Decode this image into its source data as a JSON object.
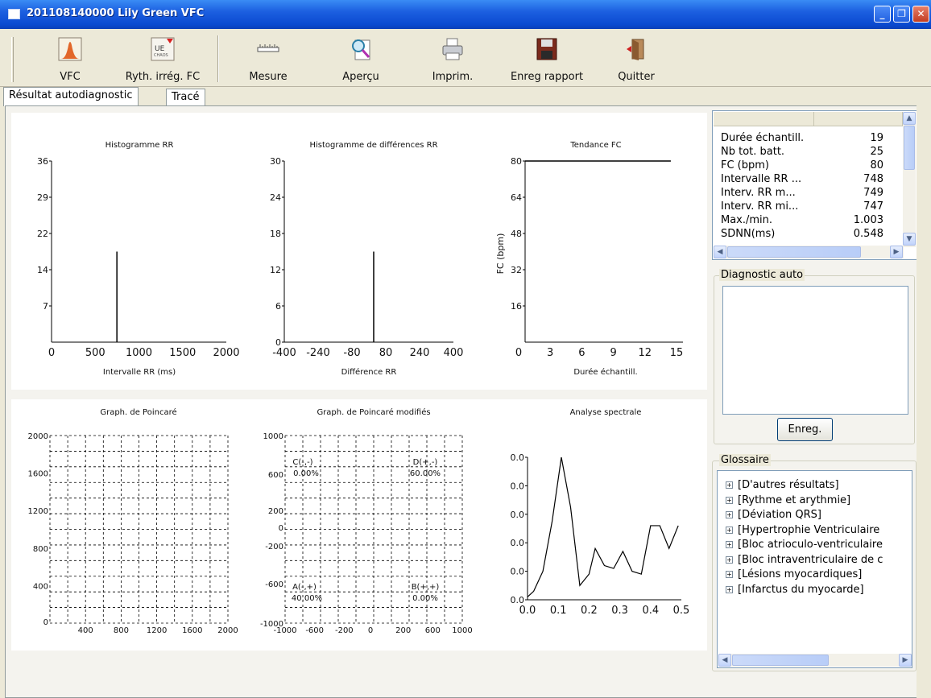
{
  "window": {
    "title": "201108140000  Lily Green  VFC",
    "minimize_glyph": "_",
    "restore_glyph": "❐",
    "close_glyph": "✕"
  },
  "toolbar": {
    "items": [
      {
        "label": "VFC",
        "icon": "hrv-chart-icon"
      },
      {
        "label": "Ryth. irrég. FC",
        "icon": "irregular-rhythm-icon"
      },
      {
        "label": "Mesure",
        "icon": "ruler-icon"
      },
      {
        "label": "Aperçu",
        "icon": "preview-magnifier-icon"
      },
      {
        "label": "Imprim.",
        "icon": "printer-icon"
      },
      {
        "label": "Enreg rapport",
        "icon": "floppy-disk-icon"
      },
      {
        "label": "Quitter",
        "icon": "exit-door-icon"
      }
    ]
  },
  "tabs": [
    {
      "label": "Résultat autodiagnostic",
      "active": true
    },
    {
      "label": "Tracé",
      "active": false
    }
  ],
  "charts": {
    "rr_histogram": {
      "title": "Histogramme RR",
      "xlabel": "Intervalle RR (ms)",
      "yticks": [
        "36",
        "29",
        "22",
        "14",
        "7"
      ],
      "xticks": [
        "0",
        "500",
        "1000",
        "1500",
        "2000"
      ]
    },
    "diff_histogram": {
      "title": "Histogramme de différences RR",
      "xlabel": "Différence RR",
      "yticks": [
        "30",
        "24",
        "18",
        "12",
        "6",
        "0"
      ],
      "xticks": [
        "-400",
        "-240",
        "-80",
        "80",
        "240",
        "400"
      ]
    },
    "hr_trend": {
      "title": "Tendance FC",
      "xlabel": "Durée échantill.",
      "ylabel": "FC (bpm)",
      "yticks": [
        "80",
        "64",
        "48",
        "32",
        "16"
      ],
      "xticks": [
        "0",
        "3",
        "6",
        "9",
        "12",
        "15"
      ]
    },
    "poincare": {
      "title": "Graph. de Poincaré",
      "yticks": [
        "2000",
        "1600",
        "1200",
        "800",
        "400",
        "0"
      ],
      "xticks": [
        "400",
        "800",
        "1200",
        "1600",
        "2000"
      ]
    },
    "poincare_mod": {
      "title": "Graph. de Poincaré modifiés",
      "yticks": [
        "1000",
        "600",
        "200",
        "0",
        "-200",
        "-600",
        "-1000"
      ],
      "xticks": [
        "-1000",
        "-600",
        "-200",
        "0",
        "200",
        "600",
        "1000"
      ],
      "q_c": "C(-,-)",
      "q_c_val": "0.00%",
      "q_d": "D(+,-)",
      "q_d_val": "60.00%",
      "q_a": "A(-,+)",
      "q_a_val": "40.00%",
      "q_b": "B(+,+)",
      "q_b_val": "0.00%"
    },
    "spectral": {
      "title": "Analyse spectrale",
      "yticks": [
        "0.0",
        "0.0",
        "0.0",
        "0.0",
        "0.0",
        "0.0"
      ],
      "xticks": [
        "0.0",
        "0.1",
        "0.2",
        "0.3",
        "0.4",
        "0.5"
      ]
    }
  },
  "chart_data": [
    {
      "type": "bar",
      "title": "Histogramme RR",
      "xlabel": "Intervalle RR (ms)",
      "xlim": [
        0,
        2000
      ],
      "ylim": [
        0,
        36
      ],
      "x": [
        748
      ],
      "values": [
        18
      ]
    },
    {
      "type": "bar",
      "title": "Histogramme de différences RR",
      "xlabel": "Différence RR",
      "xlim": [
        -400,
        400
      ],
      "ylim": [
        0,
        30
      ],
      "x": [
        0
      ],
      "values": [
        15
      ]
    },
    {
      "type": "line",
      "title": "Tendance FC",
      "xlabel": "Durée échantill.",
      "ylabel": "FC (bpm)",
      "xlim": [
        0,
        15
      ],
      "ylim": [
        0,
        80
      ],
      "x": [
        0,
        14
      ],
      "values": [
        80,
        80
      ]
    },
    {
      "type": "scatter",
      "title": "Graph. de Poincaré",
      "xlim": [
        0,
        2000
      ],
      "ylim": [
        0,
        2000
      ],
      "grid": true
    },
    {
      "type": "scatter",
      "title": "Graph. de Poincaré modifiés",
      "xlim": [
        -1000,
        1000
      ],
      "ylim": [
        -1000,
        1000
      ],
      "grid": true
    },
    {
      "type": "line",
      "title": "Analyse spectrale",
      "xlim": [
        0,
        0.5
      ],
      "x": [
        0.0,
        0.02,
        0.05,
        0.08,
        0.11,
        0.14,
        0.17,
        0.2,
        0.22,
        0.25,
        0.28,
        0.31,
        0.34,
        0.37,
        0.4,
        0.43,
        0.46,
        0.49
      ],
      "values": [
        0.02,
        0.06,
        0.2,
        0.55,
        1.0,
        0.65,
        0.1,
        0.18,
        0.36,
        0.24,
        0.22,
        0.34,
        0.2,
        0.18,
        0.52,
        0.52,
        0.36,
        0.52
      ]
    }
  ],
  "results": {
    "rows": [
      {
        "k": "Durée échantill.",
        "v": "19"
      },
      {
        "k": "Nb tot. batt.",
        "v": "25"
      },
      {
        "k": "FC (bpm)",
        "v": "80"
      },
      {
        "k": "Intervalle RR ...",
        "v": "748"
      },
      {
        "k": "Interv. RR m...",
        "v": "749"
      },
      {
        "k": "Interv. RR mi...",
        "v": "747"
      },
      {
        "k": "Max./min.",
        "v": "1.003"
      },
      {
        "k": "SDNN(ms)",
        "v": "0.548"
      }
    ]
  },
  "diagnostic": {
    "label": "Diagnostic auto",
    "save_button": "Enreg."
  },
  "glossary": {
    "label": "Glossaire",
    "items": [
      "[D'autres résultats]",
      "[Rythme et arythmie]",
      "[Déviation QRS]",
      "[Hypertrophie Ventriculaire",
      "[Bloc atrioculo-ventriculaire",
      "[Bloc intraventriculaire de c",
      "[Lésions myocardiques]",
      "[Infarctus du myocarde]"
    ]
  }
}
